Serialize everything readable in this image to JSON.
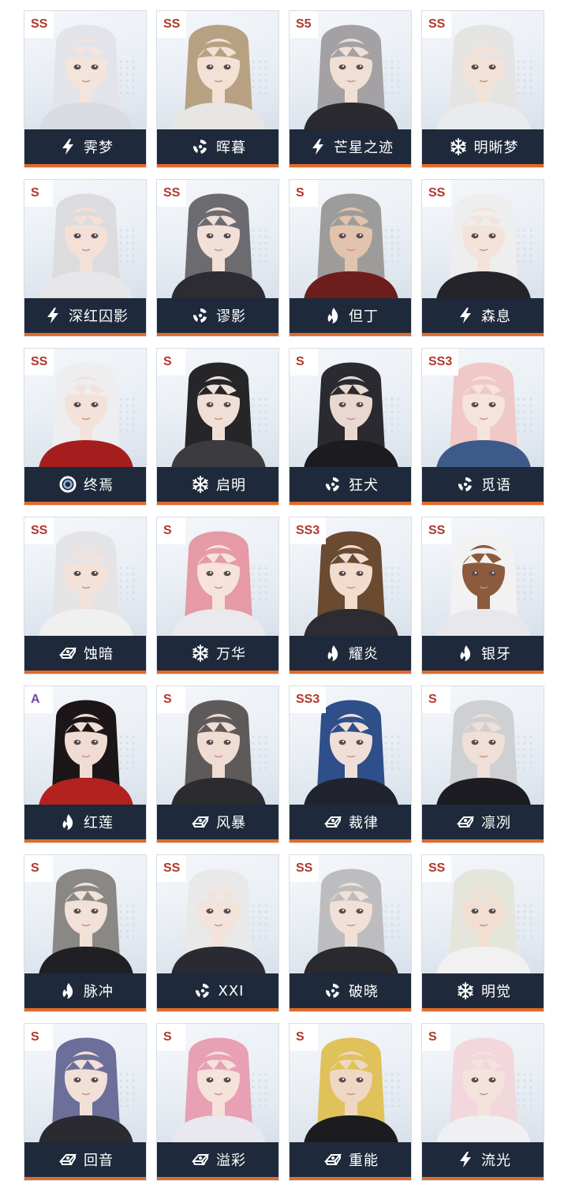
{
  "characters": [
    {
      "rank": "SS",
      "name": "霁梦",
      "element": "lightning-icon",
      "hair": "#e2e4ea",
      "skin": "#f3e4dc",
      "outfit": "#d9dbe2"
    },
    {
      "rank": "SS",
      "name": "晖暮",
      "element": "flow-icon",
      "hair": "#b8a183",
      "skin": "#f3e1d6",
      "outfit": "#e8e6e2"
    },
    {
      "rank": "S5",
      "name": "芒星之迹",
      "element": "lightning-icon",
      "hair": "#a3a1a3",
      "skin": "#f0dfd5",
      "outfit": "#2b2a30"
    },
    {
      "rank": "SS",
      "name": "明晰梦",
      "element": "ice-icon",
      "hair": "#e4e4e2",
      "skin": "#f3e2d8",
      "outfit": "#e9ebee"
    },
    {
      "rank": "S",
      "name": "深红囚影",
      "element": "lightning-icon",
      "hair": "#dcdcdf",
      "skin": "#f3e1d8",
      "outfit": "#e7e7ea"
    },
    {
      "rank": "SS",
      "name": "谬影",
      "element": "flow-icon",
      "hair": "#6c6b70",
      "skin": "#f1e0d8",
      "outfit": "#2d2c33"
    },
    {
      "rank": "S",
      "name": "但丁",
      "element": "fire-icon",
      "hair": "#9e9c9a",
      "skin": "#e2c3ad",
      "outfit": "#6e1d1d"
    },
    {
      "rank": "SS",
      "name": "森息",
      "element": "lightning-icon",
      "hair": "#eeeeee",
      "skin": "#f3e3da",
      "outfit": "#24242a"
    },
    {
      "rank": "SS",
      "name": "终焉",
      "element": "void-icon",
      "hair": "#eeeef0",
      "skin": "#f3e2da",
      "outfit": "#a51d1d"
    },
    {
      "rank": "S",
      "name": "启明",
      "element": "ice-icon",
      "hair": "#262629",
      "skin": "#efdfd6",
      "outfit": "#3b3b40"
    },
    {
      "rank": "S",
      "name": "狂犬",
      "element": "flow-icon",
      "hair": "#2a2a30",
      "skin": "#e9d8cf",
      "outfit": "#1b1b20"
    },
    {
      "rank": "SS3",
      "name": "觅语",
      "element": "flow-icon",
      "hair": "#f0c8c8",
      "skin": "#f5e4dc",
      "outfit": "#3e5a8a"
    },
    {
      "rank": "SS",
      "name": "蚀暗",
      "element": "physical-icon",
      "hair": "#e4e4e6",
      "skin": "#f3e2da",
      "outfit": "#f0f0f0"
    },
    {
      "rank": "S",
      "name": "万华",
      "element": "ice-icon",
      "hair": "#e59aa6",
      "skin": "#f6e3da",
      "outfit": "#e9e9ee"
    },
    {
      "rank": "SS3",
      "name": "耀炎",
      "element": "fire-icon",
      "hair": "#6b4a32",
      "skin": "#f1dcce",
      "outfit": "#2c2c32"
    },
    {
      "rank": "SS",
      "name": "银牙",
      "element": "fire-icon",
      "hair": "#f2f2f2",
      "skin": "#8c5a3c",
      "outfit": "#e8e8ec"
    },
    {
      "rank": "A",
      "name": "红莲",
      "element": "fire-icon",
      "hair": "#1c1618",
      "skin": "#f0dcd2",
      "outfit": "#b3221f"
    },
    {
      "rank": "S",
      "name": "风暴",
      "element": "physical-icon",
      "hair": "#5f5a5a",
      "skin": "#efdcd2",
      "outfit": "#2b2b30"
    },
    {
      "rank": "SS3",
      "name": "裁律",
      "element": "physical-icon",
      "hair": "#2e4f8a",
      "skin": "#f0dfd8",
      "outfit": "#20232e"
    },
    {
      "rank": "S",
      "name": "凛冽",
      "element": "physical-icon",
      "hair": "#cfd0d4",
      "skin": "#f0dfd6",
      "outfit": "#1c1c22"
    },
    {
      "rank": "S",
      "name": "脉冲",
      "element": "fire-icon",
      "hair": "#8a8885",
      "skin": "#f2e1d7",
      "outfit": "#202024"
    },
    {
      "rank": "SS",
      "name": "XXI",
      "element": "flow-icon",
      "hair": "#e9e9ea",
      "skin": "#f3e3da",
      "outfit": "#2a2a33"
    },
    {
      "rank": "SS",
      "name": "破晓",
      "element": "flow-icon",
      "hair": "#bdbdbf",
      "skin": "#f1e0d7",
      "outfit": "#2a2a2e"
    },
    {
      "rank": "SS",
      "name": "明觉",
      "element": "ice-icon",
      "hair": "#e4e6dc",
      "skin": "#f2dfd2",
      "outfit": "#f1f1f1"
    },
    {
      "rank": "S",
      "name": "回音",
      "element": "physical-icon",
      "hair": "#6c6f9a",
      "skin": "#f1e0d8",
      "outfit": "#2a2a30"
    },
    {
      "rank": "S",
      "name": "溢彩",
      "element": "physical-icon",
      "hair": "#e7a0b4",
      "skin": "#f5e2da",
      "outfit": "#e8e8ee"
    },
    {
      "rank": "S",
      "name": "重能",
      "element": "physical-icon",
      "hair": "#e0c25a",
      "skin": "#efd7c3",
      "outfit": "#1c1c20"
    },
    {
      "rank": "S",
      "name": "流光",
      "element": "lightning-icon",
      "hair": "#f2d7dc",
      "skin": "#f4e3dc",
      "outfit": "#f0f0f3"
    }
  ]
}
